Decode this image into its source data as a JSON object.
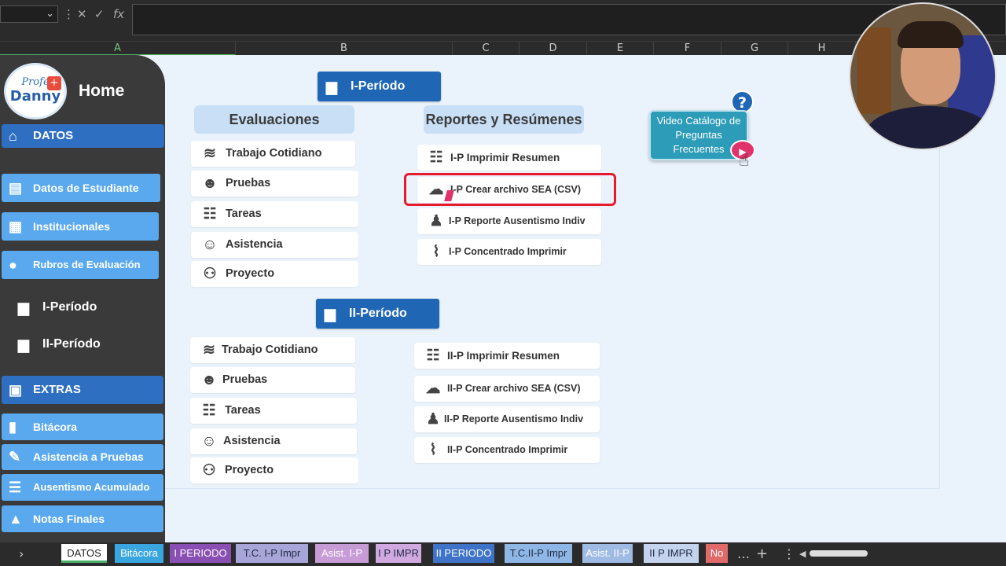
{
  "toolbar": {
    "namebox_arrow": "⌄",
    "cancel": "✕",
    "confirm": "✓",
    "fx": "fx"
  },
  "columns": [
    "A",
    "B",
    "C",
    "D",
    "E",
    "F",
    "G",
    "H"
  ],
  "sidebar": {
    "logo_top": "Profe",
    "logo_bottom": "Danny",
    "home": "Home",
    "datos": "DATOS",
    "datos_estudiante": "Datos de Estudiante",
    "institucionales": "Institucionales",
    "rubros": "Rubros de Evaluación",
    "periodo1": "I-Período",
    "periodo2": "II-Período",
    "extras": "EXTRAS",
    "bitacora": "Bitácora",
    "asistencia_pruebas": "Asistencia a Pruebas",
    "ausentismo": "Ausentismo Acumulado",
    "notas": "Notas Finales"
  },
  "periodo1": {
    "header": "I-Período",
    "evaluaciones_title": "Evaluaciones",
    "reportes_title": "Reportes  y Resúmenes",
    "evaluaciones": [
      "Trabajo Cotidiano",
      "Pruebas",
      "Tareas",
      "Asistencia",
      "Proyecto"
    ],
    "reportes": [
      "I-P Imprimir Resumen",
      "I-P Crear archivo SEA (CSV)",
      "I-P Reporte Ausentismo Indiv",
      "I-P Concentrado Imprimir"
    ]
  },
  "periodo2": {
    "header": "II-Período",
    "evaluaciones": [
      "Trabajo Cotidiano",
      "Pruebas",
      "Tareas",
      "Asistencia",
      "Proyecto"
    ],
    "reportes": [
      "II-P Imprimir Resumen",
      "II-P Crear archivo SEA (CSV)",
      "II-P Reporte Ausentismo Indiv",
      "II-P Concentrado Imprimir"
    ]
  },
  "video_card": {
    "help": "?",
    "text": "Video Catálogo de Preguntas Frecuentes"
  },
  "tabs": [
    "DATOS",
    "Bitácora",
    "I PERIODO",
    "T.C. I-P Impr",
    "Asist. I-P",
    "I P IMPR",
    "II PERIODO",
    "T.C.II-P Impr",
    "Asist. II-P",
    "II P IMPR",
    "No"
  ],
  "tab_colors": [
    "#ffffff",
    "#3aa6df",
    "#8a4fb3",
    "#a8a6d8",
    "#c79bd6",
    "#d0a9e0",
    "#3e73c7",
    "#8fb7e6",
    "#9fbbe3",
    "#c5d4ee",
    "#e06a6a"
  ]
}
